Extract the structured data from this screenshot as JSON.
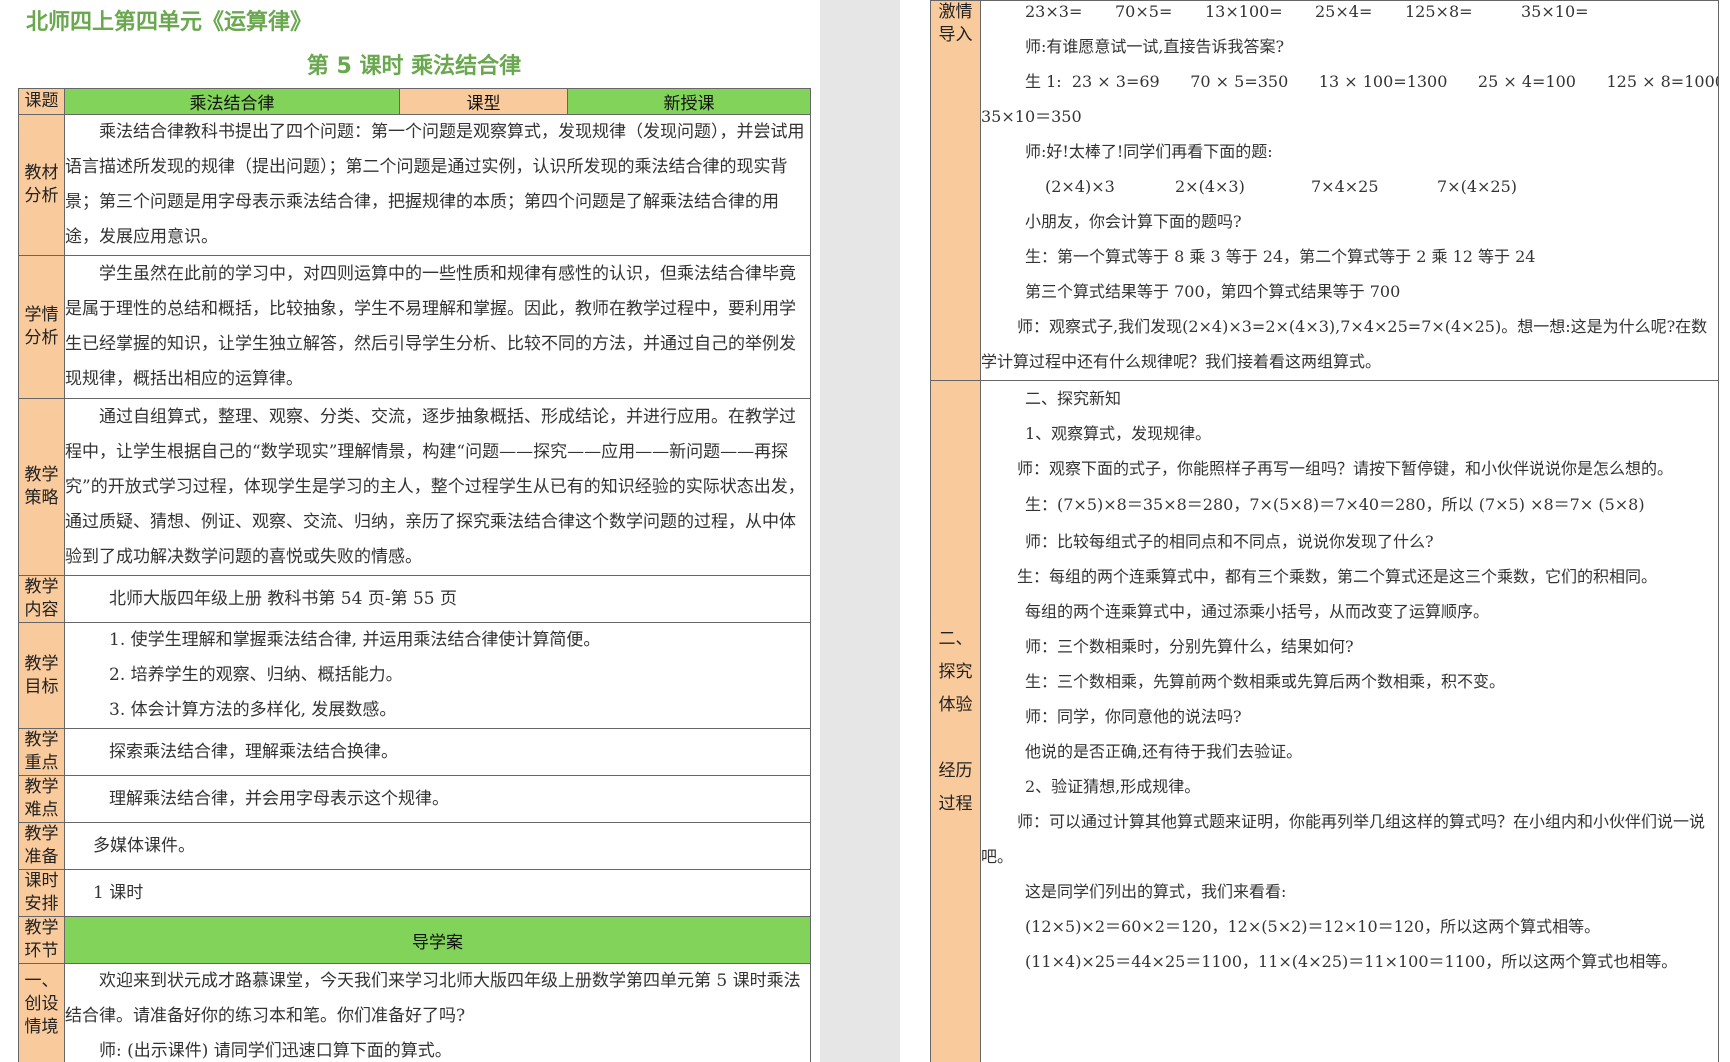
{
  "left": {
    "title": "北师四上第四单元《运算律》",
    "subtitle": "第 5 课时  乘法结合律",
    "header": {
      "label": "课题",
      "topic": "乘法结合律",
      "type_label": "课型",
      "type_value": "新授课"
    },
    "rows": {
      "textbook": {
        "label": "教材分析",
        "text": "乘法结合律教科书提出了四个问题：第一个问题是观察算式，发现规律（发现问题），并尝试用语言描述所发现的规律（提出问题）；第二个问题是通过实例，认识所发现的乘法结合律的现实背景；第三个问题是用字母表示乘法结合律，把握规律的本质；第四个问题是了解乘法结合律的用途，发展应用意识。"
      },
      "students": {
        "label": "学情分析",
        "text": "学生虽然在此前的学习中，对四则运算中的一些性质和规律有感性的认识，但乘法结合律毕竟是属于理性的总结和概括，比较抽象，学生不易理解和掌握。因此，教师在教学过程中，要利用学生已经掌握的知识，让学生独立解答，然后引导学生分析、比较不同的方法，并通过自己的举例发现规律，概括出相应的运算律。"
      },
      "strategy": {
        "label": "教学策略",
        "text": "通过自组算式，整理、观察、分类、交流，逐步抽象概括、形成结论，并进行应用。在教学过程中，让学生根据自己的“数学现实”理解情景，构建“问题——探究——应用——新问题——再探究”的开放式学习过程，体现学生是学习的主人，整个过程学生从已有的知识经验的实际状态出发，通过质疑、猜想、例证、观察、交流、归纳，亲历了探究乘法结合律这个数学问题的过程，从中体验到了成功解决数学问题的喜悦或失败的情感。"
      },
      "content": {
        "label": "教学内容",
        "text": "北师大版四年级上册  教科书第 54 页-第 55 页"
      },
      "goals": {
        "label": "教学目标",
        "items": [
          "1. 使学生理解和掌握乘法结合律, 并运用乘法结合律使计算简便。",
          "2. 培养学生的观察、归纳、概括能力。",
          "3. 体会计算方法的多样化, 发展数感。"
        ]
      },
      "key": {
        "label": "教学重点",
        "text": "探索乘法结合律，理解乘法结合换律。"
      },
      "difficulty": {
        "label": "教学难点",
        "text": "理解乘法结合律，并会用字母表示这个规律。"
      },
      "prep": {
        "label": "教学准备",
        "text": "多媒体课件。"
      },
      "schedule": {
        "label": "课时安排",
        "text": "1 课时"
      },
      "phase": {
        "label": "教学环节",
        "value": "导学案"
      },
      "intro": {
        "label": "一、创设情境",
        "text": "欢迎来到状元成才路慕课堂，今天我们来学习北师大版四年级上册数学第四单元第 5 课时乘法结合律。请准备好你的练习本和笔。你们准备好了吗?",
        "teacher": "师: (出示课件) 请同学们迅速口算下面的算式。"
      }
    }
  },
  "right": {
    "row1_label": "激情导入",
    "row1": {
      "calcs": [
        "23×3=",
        "70×5=",
        "13×100=",
        "25×4=",
        "125×8=",
        "35×10="
      ],
      "q1": "师:有谁愿意试一试,直接告诉我答案?",
      "ans_a": "生 1:  23 × 3=69      70 × 5=350      13 × 100=1300      25 × 4=100      125 × 8=1000",
      "ans_b": "35×10＝350",
      "q2": "师:好!太棒了!同学们再看下面的题:",
      "exprs": [
        "(2×4)×3",
        "2×(4×3)",
        "7×4×25",
        "7×(4×25)"
      ],
      "q3": "小朋友，你会计算下面的题吗?",
      "s1": "生：第一个算式等于 8 乘 3 等于 24，第二个算式等于 2 乘 12 等于 24",
      "s2": "第三个算式结果等于 700，第四个算式结果等于 700",
      "t1": "师：观察式子,我们发现(2×4)×3=2×(4×3),7×4×25=7×(4×25)。想一想:这是为什么呢?在数学计算过程中还有什么规律呢？我们接着看这两组算式。"
    },
    "row2_label": [
      "二、",
      "探究",
      "体验",
      "",
      "经历",
      "过程"
    ],
    "row2": {
      "h1": "二、探究新知",
      "h2": "1、观察算式，发现规律。",
      "t1": "师：观察下面的式子，你能照样子再写一组吗？请按下暂停键，和小伙伴说说你是怎么想的。",
      "s1": "生：(7×5)×8＝35×8＝280，7×(5×8)＝7×40＝280，所以 (7×5) ×8＝7× (5×8)",
      "t2": "师：比较每组式子的相同点和不同点，说说你发现了什么?",
      "s2": "生：每组的两个连乘算式中，都有三个乘数，第二个算式还是这三个乘数，它们的积相同。",
      "n1": "每组的两个连乘算式中，通过添乘小括号，从而改变了运算顺序。",
      "t3": "师：三个数相乘时，分别先算什么，结果如何?",
      "s3": "生：三个数相乘，先算前两个数相乘或先算后两个数相乘，积不变。",
      "t4": "师：同学，你同意他的说法吗?",
      "n2": "他说的是否正确,还有待于我们去验证。",
      "h3": "2、验证猜想,形成规律。",
      "t5": "师：可以通过计算其他算式题来证明，你能再列举几组这样的算式吗？在小组内和小伙伴们说一说吧。",
      "n3": "这是同学们列出的算式，我们来看看:",
      "e1": "(12×5)×2＝60×2＝120，12×(5×2)＝12×10＝120，所以这两个算式相等。",
      "e2": "(11×4)×25＝44×25＝1100，11×(4×25)＝11×100＝1100，所以这两个算式也相等。"
    }
  },
  "colors": {
    "title_green": "#6aa84f",
    "label_orange": "#f9cb9c",
    "header_green": "#82d35a",
    "gutter": "#e6e6e6"
  }
}
